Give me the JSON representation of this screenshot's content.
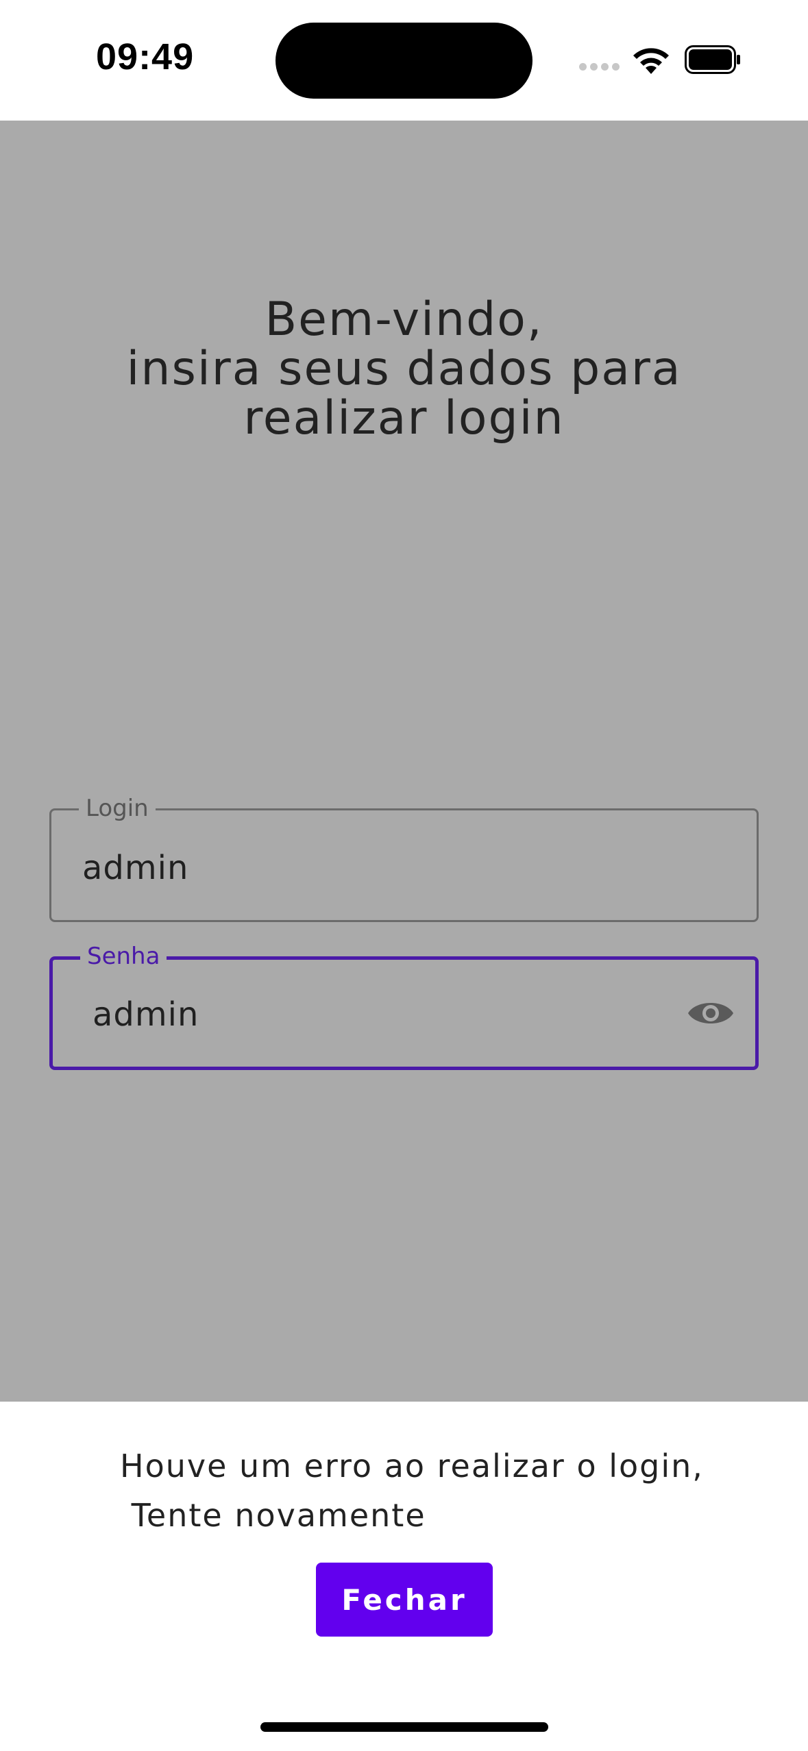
{
  "status_bar": {
    "time": "09:49",
    "icons": [
      "cellular-signal-icon",
      "wifi-icon",
      "battery-icon"
    ]
  },
  "login_screen": {
    "welcome_lines": [
      "Bem-vindo,",
      "insira seus dados para",
      "realizar login"
    ],
    "login_field": {
      "label": "Login",
      "value": "admin"
    },
    "password_field": {
      "label": "Senha",
      "value": "admin",
      "toggle_icon": "eye-icon"
    }
  },
  "error_sheet": {
    "message_lines": [
      "Houve um erro ao realizar o login,",
      " Tente novamente"
    ],
    "close_button": "Fechar"
  },
  "colors": {
    "overlay": "#aaaaaa",
    "accent": "#6200ee",
    "focused_border": "#4a1aa8"
  }
}
